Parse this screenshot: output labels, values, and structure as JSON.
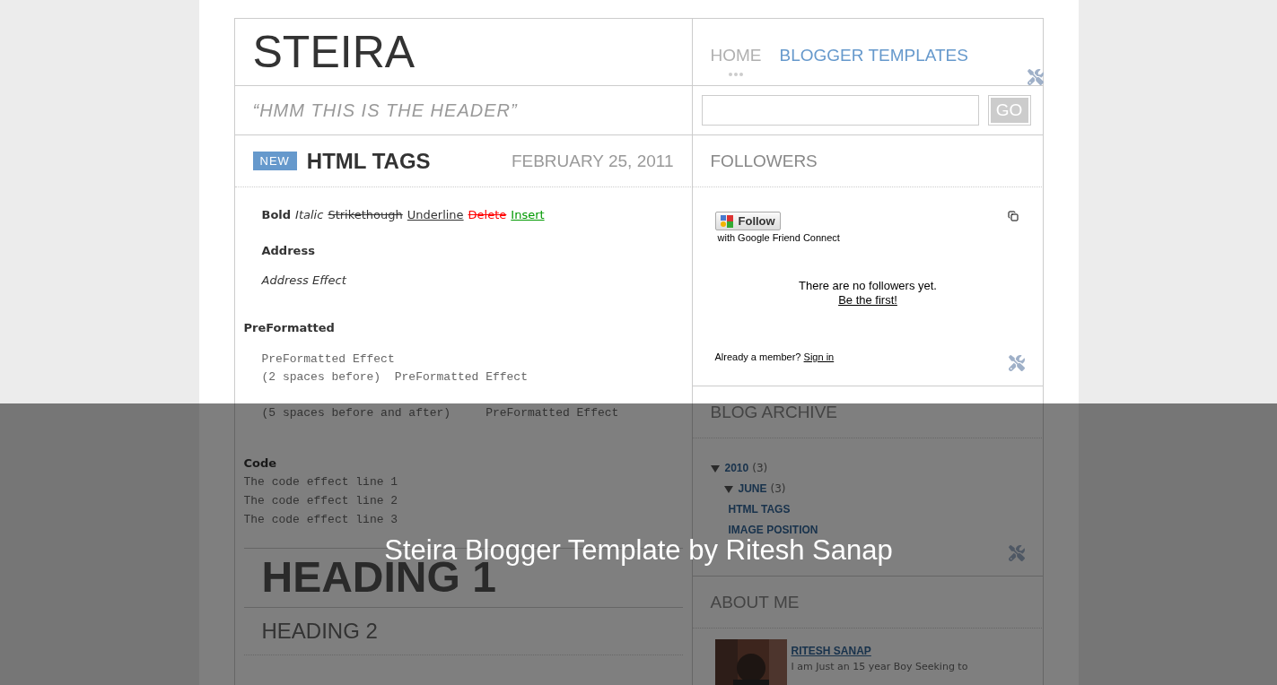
{
  "blog": {
    "title": "STEIRA",
    "description": "“HMM THIS IS THE HEADER”"
  },
  "nav": {
    "tabs": [
      {
        "label": "HOME",
        "selected": true
      },
      {
        "label": "BLOGGER TEMPLATES",
        "selected": false
      }
    ]
  },
  "search": {
    "button": "GO"
  },
  "post": {
    "badge": "NEW",
    "title": "HTML TAGS",
    "date": "FEBRUARY 25, 2011",
    "format_line": [
      {
        "kind": "bold",
        "text": "Bold"
      },
      {
        "kind": "italic",
        "text": "Italic"
      },
      {
        "kind": "strike",
        "text": "Strikethough"
      },
      {
        "kind": "underline",
        "text": "Underline"
      },
      {
        "kind": "delete",
        "text": "Delete"
      },
      {
        "kind": "insert",
        "text": "Insert"
      }
    ],
    "address_label": "Address",
    "address": "Address Effect",
    "preformatted_label": "PreFormatted",
    "preformatted": [
      [
        "PreFormatted Effect",
        "(2 spaces before)  PreFormatted Effect"
      ],
      [
        "(5 spaces before and after)     PreFormatted Effect"
      ]
    ],
    "code_label": "Code",
    "code": [
      "The code effect line 1",
      "The code effect line 2",
      "The code effect line 3"
    ],
    "heading_1": "HEADING 1",
    "heading_2": "HEADING 2"
  },
  "followers": {
    "title": "FOLLOWERS",
    "follow_button": "Follow",
    "connect_text": "with Google Friend Connect",
    "empty_text": "There are no followers yet.",
    "first_link": "Be the first!",
    "member_text": "Already a member?",
    "sign_in": "Sign in"
  },
  "archive": {
    "title": "BLOG ARCHIVE",
    "items": [
      {
        "label": "2010",
        "count": "(3)",
        "expanded": true,
        "children": [
          {
            "label": "JUNE",
            "count": "(3)",
            "expanded": true,
            "children": [
              {
                "label": "HTML TAGS"
              },
              {
                "label": "IMAGE POSITION"
              }
            ]
          }
        ]
      }
    ]
  },
  "about": {
    "title": "ABOUT ME",
    "name": "RITESH SANAP",
    "text": "I am Just an 15 year Boy Seeking to"
  },
  "caption": "Steira Blogger Template by Ritesh Sanap"
}
